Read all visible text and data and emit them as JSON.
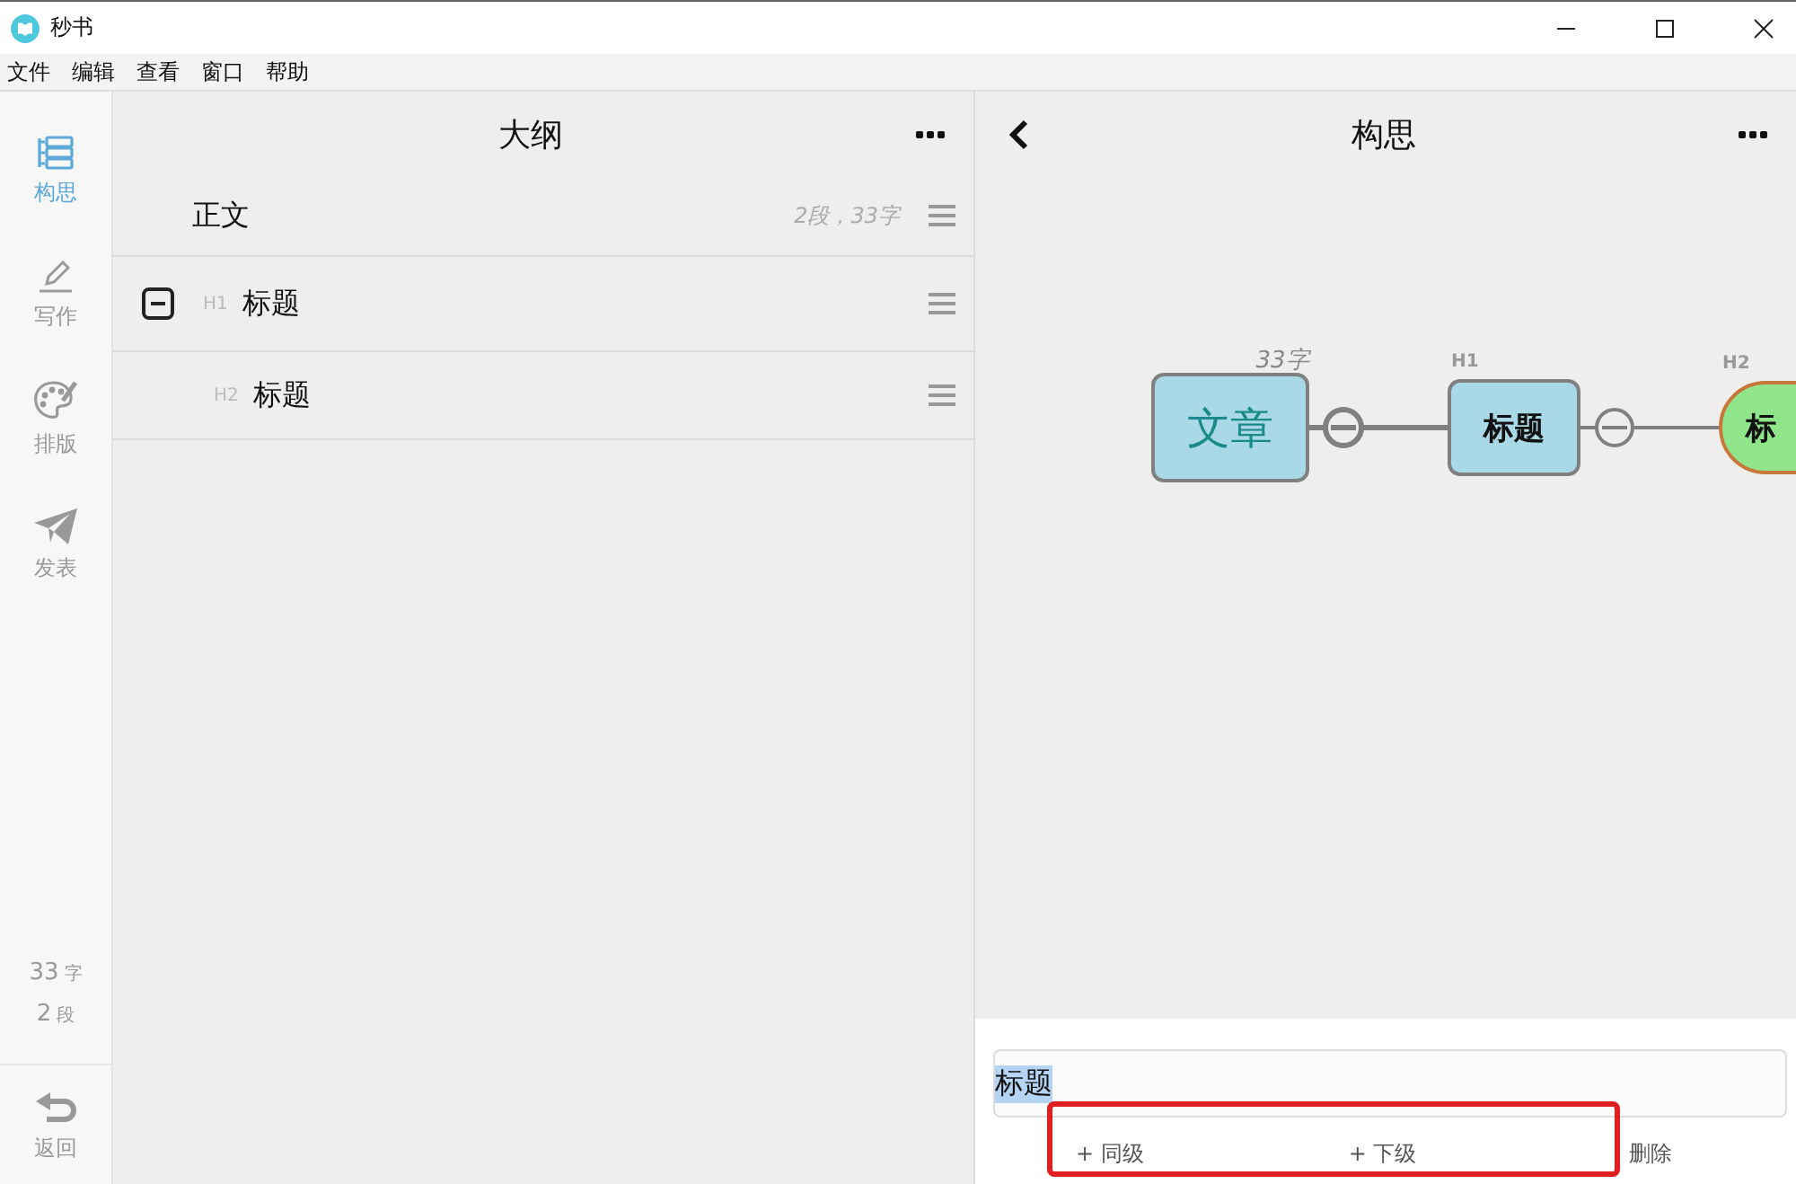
{
  "window": {
    "title": "秒书"
  },
  "menu": [
    "文件",
    "编辑",
    "查看",
    "窗口",
    "帮助"
  ],
  "sidebar": {
    "items": [
      {
        "kind": "outline",
        "label": "构思",
        "selected": true
      },
      {
        "kind": "pen",
        "label": "写作",
        "selected": false
      },
      {
        "kind": "palette",
        "label": "排版",
        "selected": false
      },
      {
        "kind": "plane",
        "label": "发表",
        "selected": false
      }
    ],
    "stats": [
      {
        "value": "33",
        "unit": "字"
      },
      {
        "value": "2",
        "unit": "段"
      }
    ],
    "back": "返回"
  },
  "outline": {
    "title": "大纲",
    "rows": [
      {
        "text": "正文",
        "meta": "2段，33字"
      },
      {
        "level": "H1",
        "text": "标题",
        "expanded": true,
        "children": [
          {
            "level": "H2",
            "text": "标题"
          }
        ]
      }
    ]
  },
  "mindmap": {
    "title": "构思",
    "nodes": [
      {
        "kind": "root",
        "text": "文章",
        "label": "33字"
      },
      {
        "kind": "h1",
        "text": "标题",
        "label": "H1"
      },
      {
        "kind": "h2",
        "text": "标",
        "label": "H2"
      }
    ]
  },
  "editor": {
    "value": "标题",
    "text_selected": true,
    "actions": [
      "+ 同级",
      "+ 下级",
      "删除"
    ]
  }
}
